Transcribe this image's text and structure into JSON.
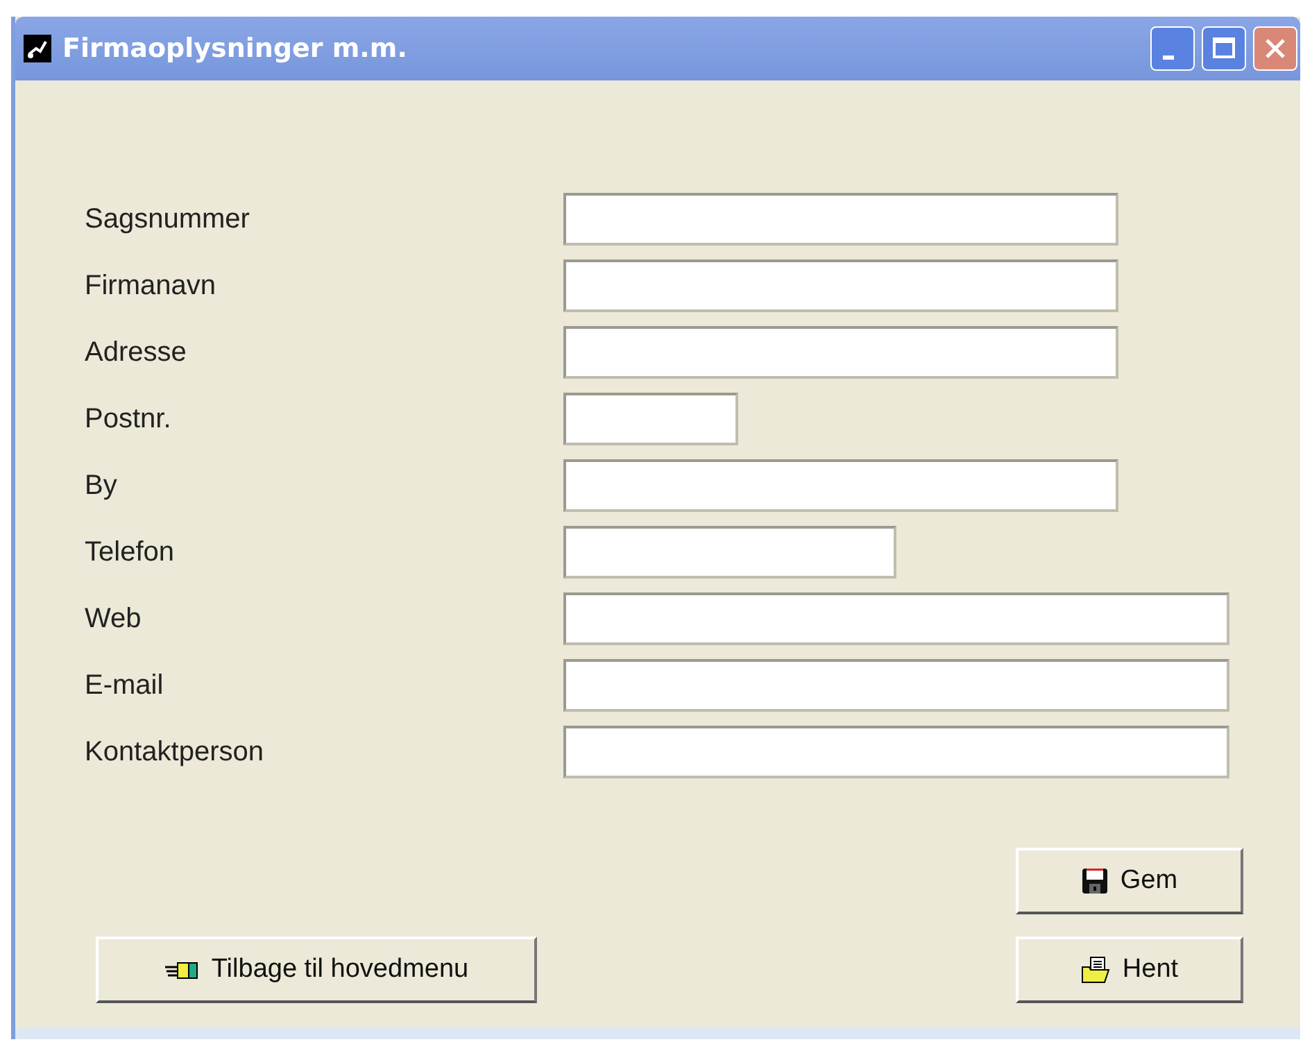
{
  "window": {
    "title": "Firmaoplysninger m.m."
  },
  "fields": [
    {
      "label": "Sagsnummer",
      "kind": "long"
    },
    {
      "label": "Firmanavn",
      "kind": "long"
    },
    {
      "label": "Adresse",
      "kind": "long"
    },
    {
      "label": "Postnr.",
      "kind": "short"
    },
    {
      "label": "By",
      "kind": "long"
    },
    {
      "label": "Telefon",
      "kind": "medium"
    },
    {
      "label": "Web",
      "kind": "wide"
    },
    {
      "label": "E-mail",
      "kind": "wide"
    },
    {
      "label": "Kontaktperson",
      "kind": "wide"
    }
  ],
  "buttons": [
    {
      "label": "Gem",
      "kind": "save"
    },
    {
      "label": "Tilbage til hovedmenu",
      "kind": "back"
    },
    {
      "label": "Hent",
      "kind": "open"
    }
  ]
}
